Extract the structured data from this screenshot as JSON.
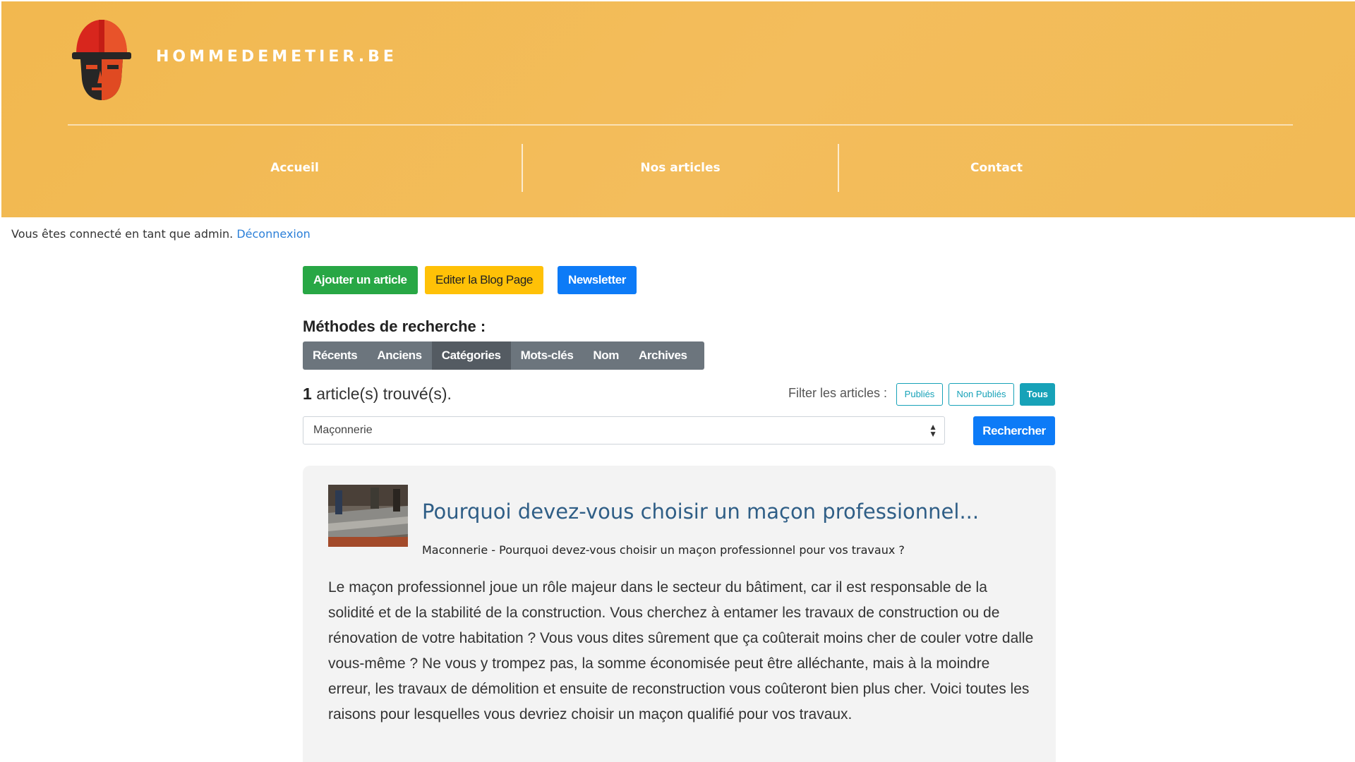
{
  "header": {
    "brand": "HOMMEDEMETIER.BE",
    "nav": [
      "Accueil",
      "Nos articles",
      "Contact"
    ]
  },
  "session": {
    "message": "Vous êtes connecté en tant que admin.",
    "logout": "Déconnexion"
  },
  "actions": {
    "add_article": "Ajouter un article",
    "edit_blog": "Editer la Blog Page",
    "newsletter": "Newsletter"
  },
  "search": {
    "title": "Méthodes de recherche :",
    "methods": [
      "Récents",
      "Anciens",
      "Catégories",
      "Mots-clés",
      "Nom",
      "Archives"
    ],
    "active_method": "Catégories",
    "count": "1",
    "count_suffix": "article(s) trouvé(s).",
    "filter_label": "Filter les articles :",
    "filters": [
      "Publiés",
      "Non Publiés",
      "Tous"
    ],
    "active_filter": "Tous",
    "category_value": "Maçonnerie",
    "search_button": "Rechercher"
  },
  "article": {
    "title": "Pourquoi devez-vous choisir un maçon professionnel...",
    "subtitle": "Maconnerie - Pourquoi devez-vous choisir un maçon professionnel pour vos travaux ?",
    "body": "Le maçon professionnel joue un rôle majeur dans le secteur du bâtiment, car il est responsable de la solidité et de la stabilité de la construction. Vous cherchez à entamer les travaux de construction ou de rénovation de votre habitation ? Vous vous dites sûrement que ça coûterait moins cher de couler votre dalle vous-même ? Ne vous y trompez pas, la somme économisée peut être alléchante, mais à la moindre erreur, les travaux de démolition et ensuite de reconstruction vous coûteront bien plus cher. Voici toutes les raisons pour lesquelles vous devriez choisir un maçon qualifié pour vos travaux."
  },
  "colors": {
    "header": "#f2b84f",
    "green": "#28a745",
    "yellow": "#ffc107",
    "blue": "#0d7bf7",
    "teal": "#17a2b8",
    "title_blue": "#2f5e86"
  }
}
